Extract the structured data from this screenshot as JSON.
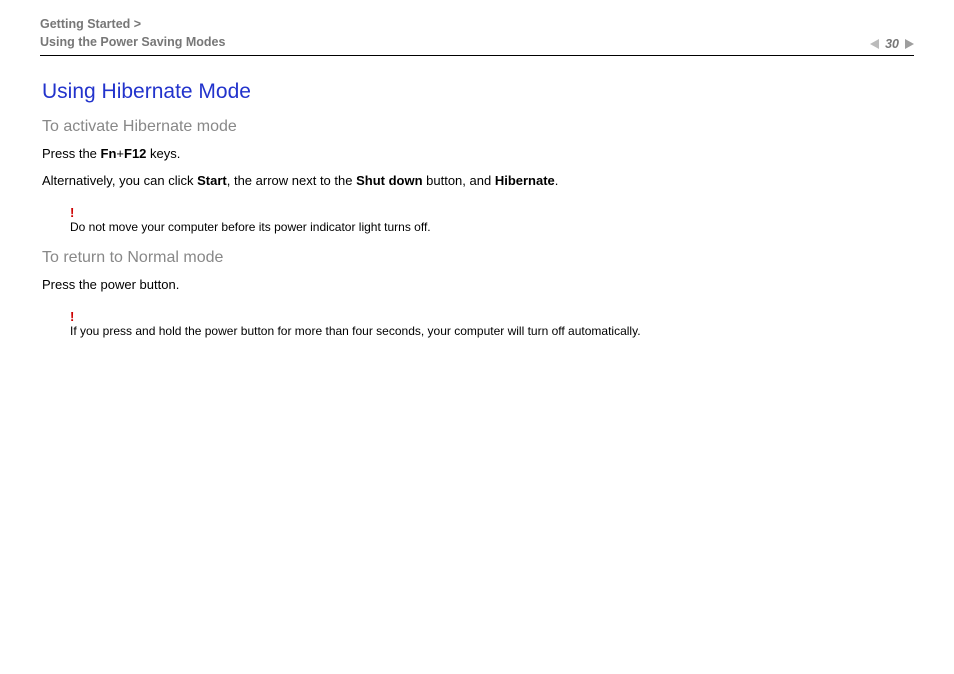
{
  "header": {
    "breadcrumb_line1": "Getting Started >",
    "breadcrumb_line2": "Using the Power Saving Modes",
    "page_number": "30"
  },
  "content": {
    "h1": "Using Hibernate Mode",
    "section1": {
      "heading": "To activate Hibernate mode",
      "p1_pre": "Press the ",
      "p1_b1": "Fn",
      "p1_plus": "+",
      "p1_b2": "F12",
      "p1_post": " keys.",
      "p2_pre": "Alternatively, you can click ",
      "p2_b1": "Start",
      "p2_mid1": ", the arrow next to the ",
      "p2_b2": "Shut down",
      "p2_mid2": " button, and ",
      "p2_b3": "Hibernate",
      "p2_post": ".",
      "note_mark": "!",
      "note_text": "Do not move your computer before its power indicator light turns off."
    },
    "section2": {
      "heading": "To return to Normal mode",
      "p1": "Press the power button.",
      "note_mark": "!",
      "note_text": "If you press and hold the power button for more than four seconds, your computer will turn off automatically."
    }
  }
}
